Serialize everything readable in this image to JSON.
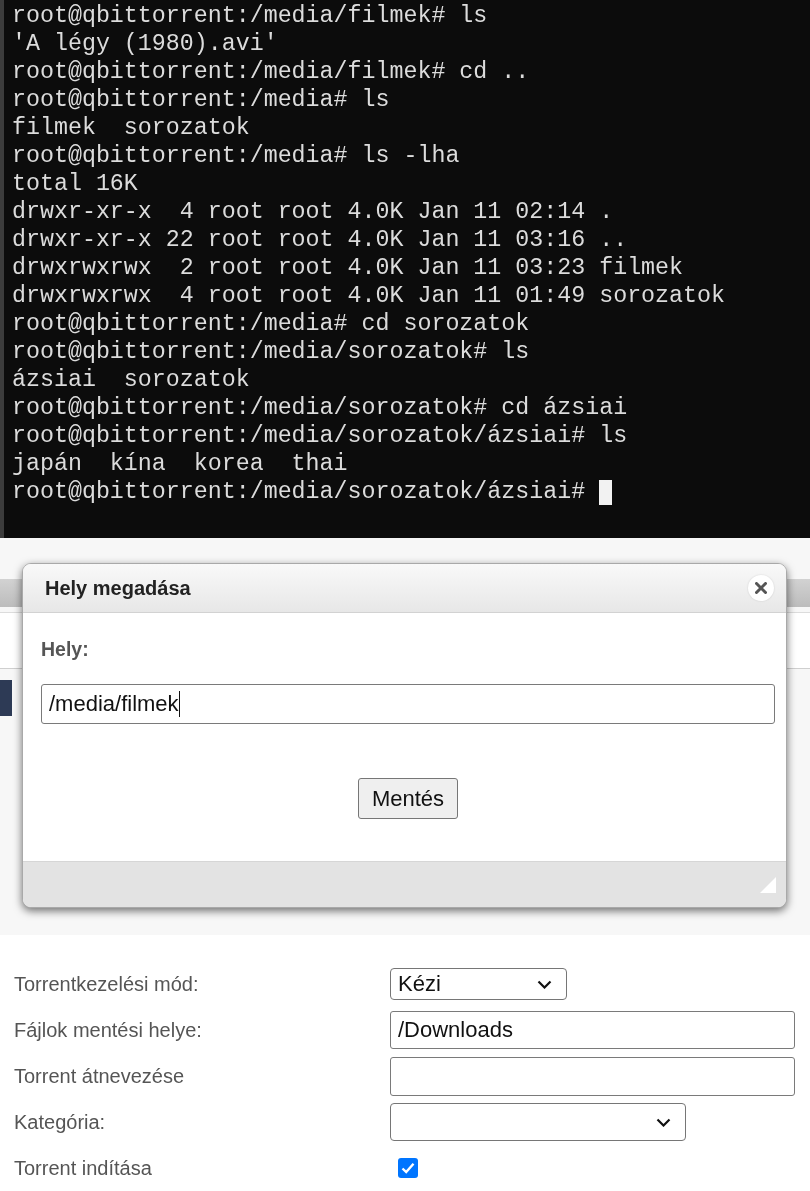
{
  "terminal": {
    "lines": [
      "root@qbittorrent:/media/filmek# ls",
      "'A légy (1980).avi'",
      "root@qbittorrent:/media/filmek# cd ..",
      "root@qbittorrent:/media# ls",
      "filmek  sorozatok",
      "root@qbittorrent:/media# ls -lha",
      "total 16K",
      "drwxr-xr-x  4 root root 4.0K Jan 11 02:14 .",
      "drwxr-xr-x 22 root root 4.0K Jan 11 03:16 ..",
      "drwxrwxrwx  2 root root 4.0K Jan 11 03:23 filmek",
      "drwxrwxrwx  4 root root 4.0K Jan 11 01:49 sorozatok",
      "root@qbittorrent:/media# cd sorozatok",
      "root@qbittorrent:/media/sorozatok# ls",
      "ázsiai  sorozatok",
      "root@qbittorrent:/media/sorozatok# cd ázsiai",
      "root@qbittorrent:/media/sorozatok/ázsiai# ls",
      "japán  kína  korea  thai",
      "root@qbittorrent:/media/sorozatok/ázsiai#"
    ],
    "cursor_visible": true
  },
  "dialog": {
    "title": "Hely megadása",
    "field_label": "Hely:",
    "field": {
      "value": "/media/filmek",
      "focused": true
    },
    "button": "Mentés"
  },
  "form": {
    "rows": [
      {
        "kind": "select",
        "label": "Torrentkezelési mód:",
        "value": "Kézi"
      },
      {
        "kind": "input",
        "label": "Fájlok mentési helye:",
        "value": "/Downloads"
      },
      {
        "kind": "input",
        "label": "Torrent átnevezése"
      },
      {
        "kind": "select",
        "label": "Kategória:"
      },
      {
        "kind": "checkbox",
        "label": "Torrent indítása",
        "checked": true
      }
    ]
  }
}
